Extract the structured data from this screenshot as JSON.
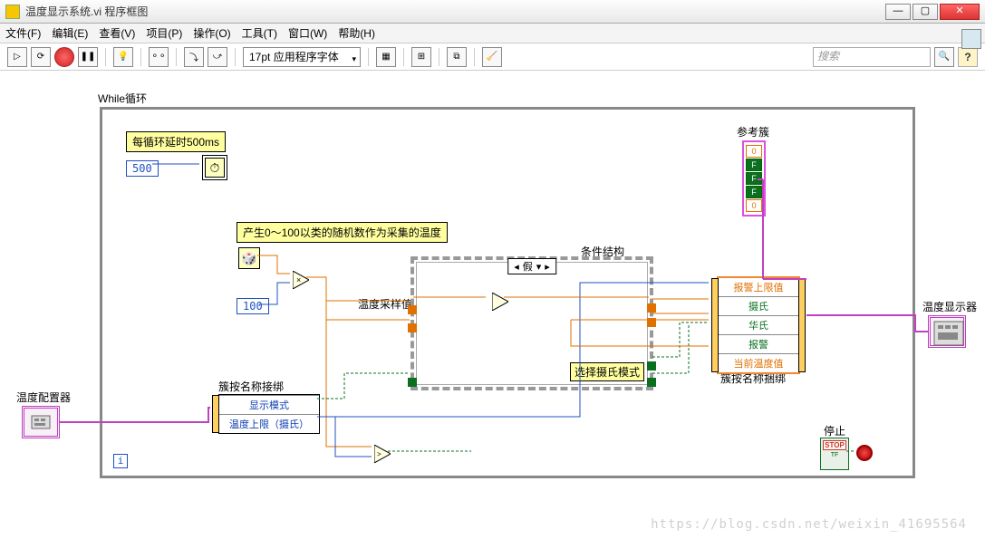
{
  "window": {
    "title": "温度显示系统.vi 程序框图"
  },
  "menu": {
    "file": "文件(F)",
    "edit": "编辑(E)",
    "view": "查看(V)",
    "project": "项目(P)",
    "operate": "操作(O)",
    "tools": "工具(T)",
    "window": "窗口(W)",
    "help": "帮助(H)"
  },
  "toolbar": {
    "font": "17pt 应用程序字体",
    "search_placeholder": "搜索"
  },
  "labels": {
    "while": "While循环",
    "delay_comment": "每循环延时500ms",
    "rand_comment": "产生0～100以类的随机数作为采集的温度",
    "case_label": "条件结构",
    "case_sel": "假",
    "case_note": "选择摄氏模式",
    "sample_label": "温度采样值",
    "unbundle_label": "簇按名称接绑",
    "bundle_label": "簇按名称捆绑",
    "ref_label": "参考簇",
    "config_label": "温度配置器",
    "display_label": "温度显示器",
    "stop_label": "停止"
  },
  "constants": {
    "c500": "500",
    "c100": "100"
  },
  "unbundle": {
    "r1": "显示模式",
    "r2": "温度上限（摄氏）"
  },
  "bundle": {
    "r1": "报警上限值",
    "r2": "摄氏",
    "r3": "华氏",
    "r4": "报警",
    "r5": "当前温度值"
  },
  "ref_cells": {
    "a": "0",
    "b": "F",
    "c": "F",
    "d": "F",
    "e": "0"
  },
  "stop": {
    "btn": "STOP",
    "tf": "TF"
  },
  "iter": "i",
  "watermark": "https://blog.csdn.net/weixin_41695564"
}
